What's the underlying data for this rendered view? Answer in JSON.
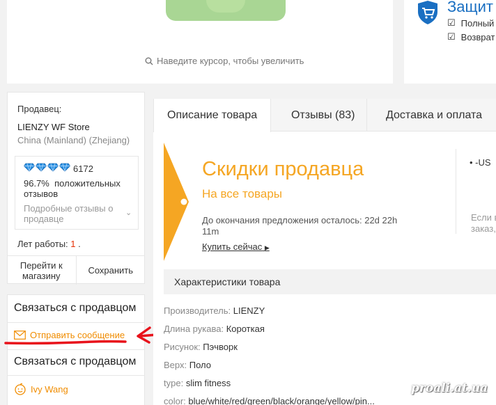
{
  "gallery": {
    "zoom_hint": "Наведите курсор, чтобы увеличить"
  },
  "protection": {
    "title": "Защит",
    "items": [
      "Полный",
      "Возврат"
    ]
  },
  "seller": {
    "label": "Продавец:",
    "store_name": "LIENZY WF Store",
    "location": "China (Mainland) (Zhejiang)",
    "feedback_score": "6172",
    "positive_pct": "96.7%",
    "positive_text": "положительных отзывов",
    "detail_link": "Подробные отзывы о продавце",
    "years_label": "Лет работы:",
    "years_value": "1",
    "years_suffix": ".",
    "visit_store": "Перейти к магазину",
    "save": "Сохранить"
  },
  "contact": {
    "title": "Связаться с продавцом",
    "send_message": "Отправить сообщение",
    "title2": "Связаться с продавцом",
    "agent_name": "Ivy Wang"
  },
  "tabs": [
    "Описание товара",
    "Отзывы (83)",
    "Доставка и оплата"
  ],
  "promo": {
    "title": "Скидки продавца",
    "subtitle": "На все товары",
    "countdown": "До окончания предложения осталось: 22d 22h 11m",
    "buy_now": "Купить сейчас",
    "right_item": "• -US",
    "right_note": "Если в\nзаказ,"
  },
  "specs": {
    "header": "Характеристики товара",
    "rows": [
      {
        "key": "Производитель:",
        "value": "LIENZY"
      },
      {
        "key": "Длина рукава:",
        "value": "Короткая"
      },
      {
        "key": "Рисунок:",
        "value": "Пэчворк"
      },
      {
        "key": "Верх:",
        "value": "Поло"
      },
      {
        "key": "type:",
        "value": "slim fitness"
      },
      {
        "key": "color:",
        "value": "blue/white/red/green/black/orange/yellow/pin..."
      }
    ]
  },
  "watermark": "proali.at.ua",
  "colors": {
    "accent_orange": "#f5a623",
    "link_orange": "#f08c00",
    "annotation_red": "#e8121b",
    "brand_blue": "#1a6fc2"
  }
}
